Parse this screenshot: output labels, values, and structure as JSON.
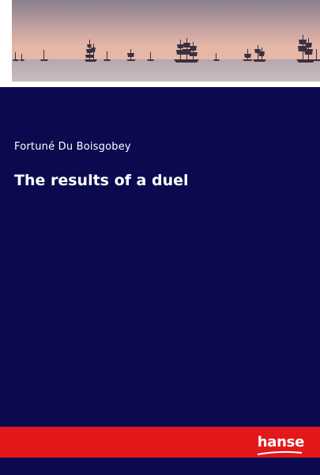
{
  "book": {
    "author": "Fortuné Du Boisgobey",
    "title": "The results of a duel",
    "publisher_logo": "hanse"
  },
  "cover_image": {
    "subject": "tall-ships-at-sea-photo"
  },
  "colors": {
    "panel": "#0c0a4e",
    "band": "#e2181b",
    "text": "#ffffff"
  }
}
